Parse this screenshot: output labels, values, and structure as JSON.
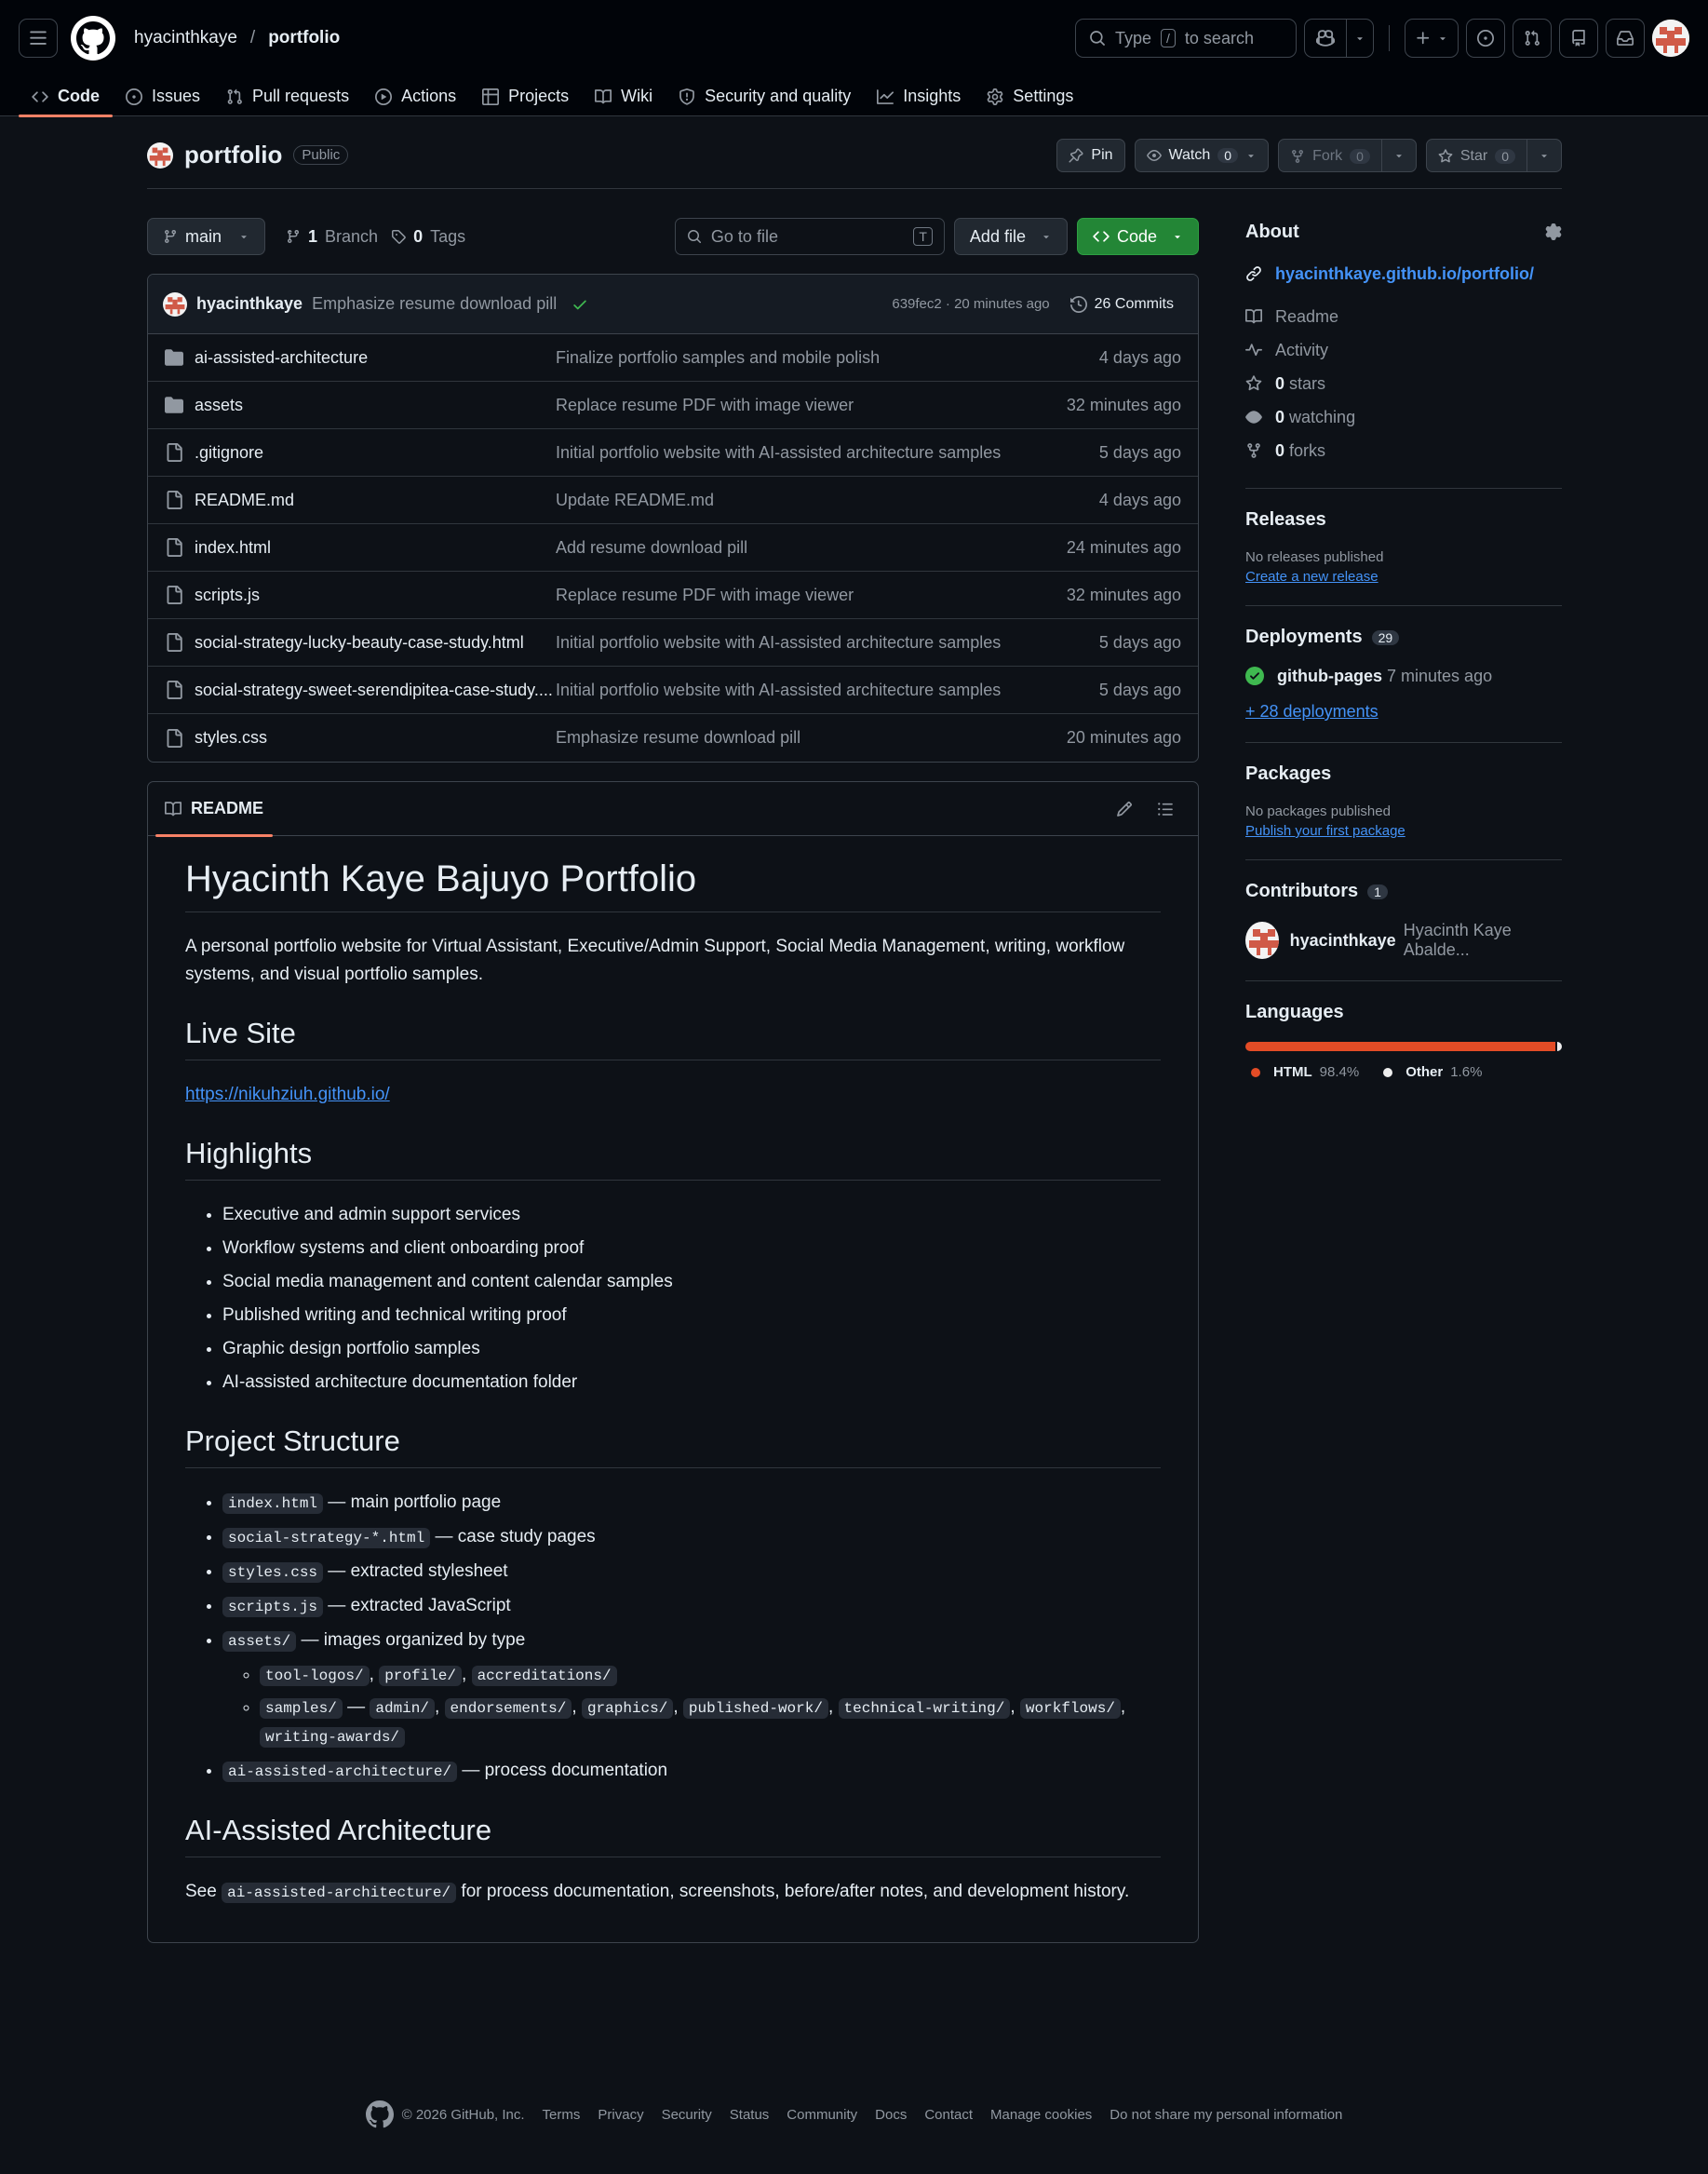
{
  "header": {
    "owner": "hyacinthkaye",
    "separator": "/",
    "repo": "portfolio",
    "search_text": "Type",
    "search_key": "/",
    "search_suffix": "to search"
  },
  "tabs": [
    {
      "label": "Code"
    },
    {
      "label": "Issues"
    },
    {
      "label": "Pull requests"
    },
    {
      "label": "Actions"
    },
    {
      "label": "Projects"
    },
    {
      "label": "Wiki"
    },
    {
      "label": "Security and quality"
    },
    {
      "label": "Insights"
    },
    {
      "label": "Settings"
    }
  ],
  "repohead": {
    "name": "portfolio",
    "visibility": "Public",
    "pin": "Pin",
    "watch": "Watch",
    "watch_count": "0",
    "fork": "Fork",
    "fork_count": "0",
    "star": "Star",
    "star_count": "0"
  },
  "toolbar": {
    "branch": "main",
    "branch_count": "1",
    "branch_label": "Branch",
    "tag_count": "0",
    "tag_label": "Tags",
    "goto_placeholder": "Go to file",
    "goto_key": "T",
    "add_file": "Add file",
    "code": "Code"
  },
  "commit": {
    "author": "hyacinthkaye",
    "message": "Emphasize resume download pill",
    "hash_time": "639fec2 · 20 minutes ago",
    "commits": "26 Commits"
  },
  "files": [
    {
      "type": "dir",
      "name": "ai-assisted-architecture",
      "msg": "Finalize portfolio samples and mobile polish",
      "age": "4 days ago"
    },
    {
      "type": "dir",
      "name": "assets",
      "msg": "Replace resume PDF with image viewer",
      "age": "32 minutes ago"
    },
    {
      "type": "file",
      "name": ".gitignore",
      "msg": "Initial portfolio website with AI-assisted architecture samples",
      "age": "5 days ago"
    },
    {
      "type": "file",
      "name": "README.md",
      "msg": "Update README.md",
      "age": "4 days ago"
    },
    {
      "type": "file",
      "name": "index.html",
      "msg": "Add resume download pill",
      "age": "24 minutes ago"
    },
    {
      "type": "file",
      "name": "scripts.js",
      "msg": "Replace resume PDF with image viewer",
      "age": "32 minutes ago"
    },
    {
      "type": "file",
      "name": "social-strategy-lucky-beauty-case-study.html",
      "msg": "Initial portfolio website with AI-assisted architecture samples",
      "age": "5 days ago"
    },
    {
      "type": "file",
      "name": "social-strategy-sweet-serendipitea-case-study....",
      "msg": "Initial portfolio website with AI-assisted architecture samples",
      "age": "5 days ago"
    },
    {
      "type": "file",
      "name": "styles.css",
      "msg": "Emphasize resume download pill",
      "age": "20 minutes ago"
    }
  ],
  "readme": {
    "tab": "README",
    "h1": "Hyacinth Kaye Bajuyo Portfolio",
    "intro": "A personal portfolio website for Virtual Assistant, Executive/Admin Support, Social Media Management, writing, workflow systems, and visual portfolio samples.",
    "live_h": "Live Site",
    "live_link": "https://nikuhziuh.github.io/",
    "highlights_h": "Highlights",
    "highlights": [
      "Executive and admin support services",
      "Workflow systems and client onboarding proof",
      "Social media management and content calendar samples",
      "Published writing and technical writing proof",
      "Graphic design portfolio samples",
      "AI-assisted architecture documentation folder"
    ],
    "structure_h": "Project Structure",
    "structure": [
      {
        "code": "index.html",
        "text": " — main portfolio page"
      },
      {
        "code": "social-strategy-*.html",
        "text": " — case study pages"
      },
      {
        "code": "styles.css",
        "text": " — extracted stylesheet"
      },
      {
        "code": "scripts.js",
        "text": " — extracted JavaScript"
      },
      {
        "code": "assets/",
        "text": " — images organized by type"
      },
      {
        "code": "ai-assisted-architecture/",
        "text": " — process documentation"
      }
    ],
    "assets_sub1": [
      "tool-logos/",
      "profile/",
      "accreditations/"
    ],
    "assets_sub2_lead": "samples/",
    "assets_sub2_dash": " — ",
    "assets_sub2": [
      "admin/",
      "endorsements/",
      "graphics/",
      "published-work/",
      "technical-writing/",
      "workflows/",
      "writing-awards/"
    ],
    "ai_h": "AI-Assisted Architecture",
    "ai_see": "See ",
    "ai_code": "ai-assisted-architecture/",
    "ai_rest": " for process documentation, screenshots, before/after notes, and development history."
  },
  "sidebar": {
    "about": "About",
    "site_link": "hyacinthkaye.github.io/portfolio/",
    "readme": "Readme",
    "activity": "Activity",
    "stars_n": "0",
    "stars": "stars",
    "watching_n": "0",
    "watching": "watching",
    "forks_n": "0",
    "forks": "forks",
    "releases": "Releases",
    "no_releases": "No releases published",
    "create_release": "Create a new release",
    "deployments": "Deployments",
    "deploy_count": "29",
    "deploy_name": "github-pages",
    "deploy_time": "7 minutes ago",
    "more_deploys": "+ 28 deployments",
    "packages": "Packages",
    "no_packages": "No packages published",
    "publish_package": "Publish your first package",
    "contributors": "Contributors",
    "contrib_count": "1",
    "contrib_login": "hyacinthkaye",
    "contrib_name": "Hyacinth Kaye Abalde...",
    "languages": "Languages",
    "langs": [
      {
        "name": "HTML",
        "pct": "98.4%",
        "value": 98.4,
        "color": "#e34c26"
      },
      {
        "name": "Other",
        "pct": "1.6%",
        "value": 1.6,
        "color": "#ededed"
      }
    ]
  },
  "footer": {
    "copyright": "© 2026 GitHub, Inc.",
    "links": [
      "Terms",
      "Privacy",
      "Security",
      "Status",
      "Community",
      "Docs",
      "Contact",
      "Manage cookies",
      "Do not share my personal information"
    ]
  },
  "colors": {
    "accent": "#f78166",
    "link": "#4493f8",
    "green": "#238636",
    "success": "#3fb950"
  }
}
